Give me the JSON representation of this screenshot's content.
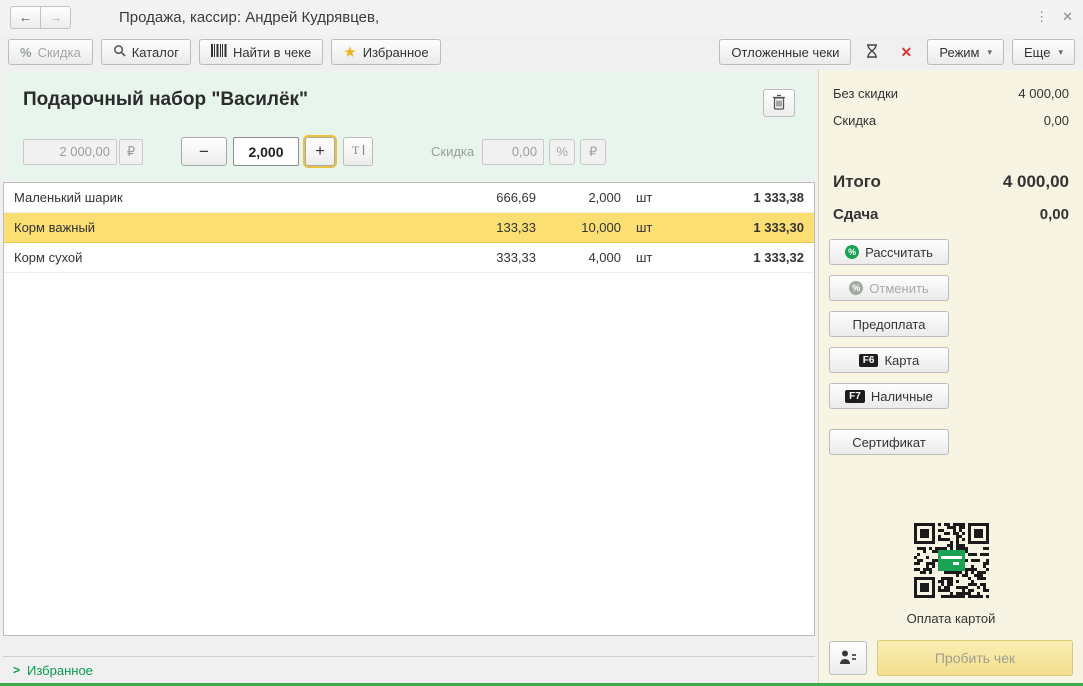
{
  "window": {
    "title": "Продажа, кассир: Андрей Кудрявцев,"
  },
  "icons": {
    "percent": "%",
    "star": "★",
    "close": "✕",
    "red_x": "✕",
    "back": "←",
    "forward": "→",
    "caret": "▾",
    "kebab": "⋮",
    "chevron_right": ">"
  },
  "toolbar": {
    "discount": "Скидка",
    "catalog": "Каталог",
    "find_in_receipt": "Найти в чеке",
    "favorites": "Избранное",
    "deferred": "Отложенные чеки",
    "mode": "Режим",
    "more": "Еще"
  },
  "product": {
    "name": "Подарочный набор \"Василёк\"",
    "price": "2 000,00",
    "currency": "₽",
    "minus": "−",
    "plus": "+",
    "quantity": "2,000",
    "discount_label": "Скидка",
    "discount_value": "0,00",
    "percent": "%",
    "ruble": "₽"
  },
  "items": [
    {
      "name": "Маленький шарик",
      "price": "666,69",
      "qty": "2,000",
      "unit": "шт",
      "total": "1 333,38"
    },
    {
      "name": "Корм важный",
      "price": "133,33",
      "qty": "10,000",
      "unit": "шт",
      "total": "1 333,30"
    },
    {
      "name": "Корм сухой",
      "price": "333,33",
      "qty": "4,000",
      "unit": "шт",
      "total": "1 333,32"
    }
  ],
  "footer": {
    "favorites": "Избранное"
  },
  "summary": {
    "no_discount_label": "Без скидки",
    "no_discount_value": "4 000,00",
    "discount_label": "Скидка",
    "discount_value": "0,00",
    "total_label": "Итого",
    "total_value": "4 000,00",
    "change_label": "Сдача",
    "change_value": "0,00"
  },
  "payment": {
    "calculate": "Рассчитать",
    "cancel": "Отменить",
    "prepayment": "Предоплата",
    "card": "Карта",
    "card_key": "F6",
    "cash": "Наличные",
    "cash_key": "F7",
    "certificate": "Сертификат",
    "qr_caption": "Оплата картой",
    "print": "Пробить чек"
  }
}
